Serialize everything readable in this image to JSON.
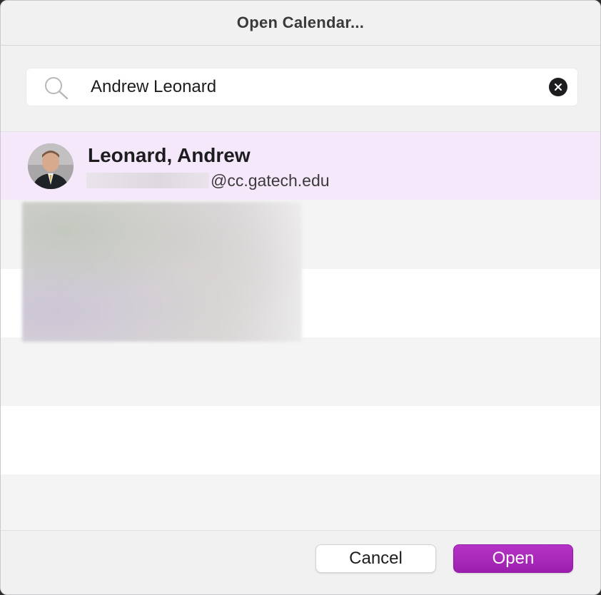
{
  "dialog": {
    "title": "Open Calendar..."
  },
  "search": {
    "value": "Andrew Leonard",
    "search_icon": "search-icon",
    "clear_icon": "clear-icon"
  },
  "results": [
    {
      "name": "Leonard, Andrew",
      "email_domain": "@cc.gatech.edu",
      "selected": true
    }
  ],
  "footer": {
    "cancel_label": "Cancel",
    "open_label": "Open"
  },
  "colors": {
    "accent": "#a62ab9",
    "selected_row": "#f5e8fb"
  }
}
